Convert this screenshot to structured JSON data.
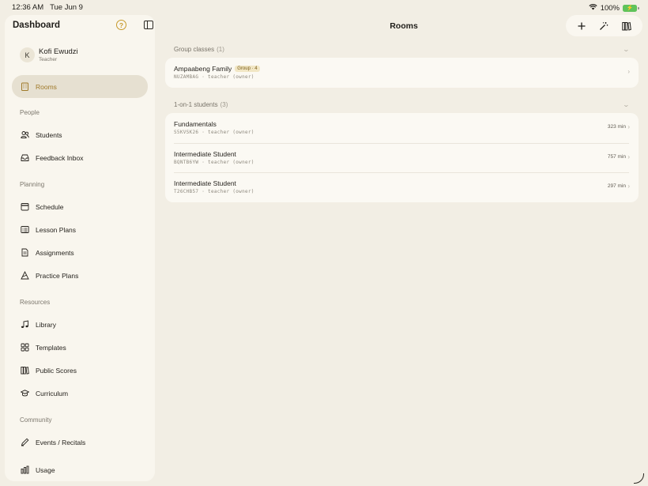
{
  "status": {
    "time": "12:36 AM",
    "date": "Tue Jun 9",
    "battery": "100%"
  },
  "sidebar": {
    "title": "Dashboard",
    "profile": {
      "initial": "K",
      "name": "Kofi Ewudzi",
      "role": "Teacher"
    },
    "items": [
      {
        "label": "Rooms",
        "icon": "building-icon"
      },
      {
        "label": "Students",
        "icon": "people-icon"
      },
      {
        "label": "Feedback Inbox",
        "icon": "inbox-icon"
      },
      {
        "label": "Schedule",
        "icon": "calendar-icon"
      },
      {
        "label": "Lesson Plans",
        "icon": "list-icon"
      },
      {
        "label": "Assignments",
        "icon": "document-icon"
      },
      {
        "label": "Practice Plans",
        "icon": "practice-icon"
      },
      {
        "label": "Library",
        "icon": "music-notes-icon"
      },
      {
        "label": "Templates",
        "icon": "grid-icon"
      },
      {
        "label": "Public Scores",
        "icon": "books-icon"
      },
      {
        "label": "Curriculum",
        "icon": "graduation-cap-icon"
      },
      {
        "label": "Events / Recitals",
        "icon": "pen-icon"
      },
      {
        "label": "Usage",
        "icon": "chart-icon"
      }
    ],
    "sections": [
      "People",
      "Planning",
      "Resources",
      "Community"
    ]
  },
  "main": {
    "title": "Rooms",
    "groups": [
      {
        "title": "Group classes",
        "count": "(1)",
        "rows": [
          {
            "title": "Ampaabeng Family",
            "badge": "Group · 4",
            "sub": "NUZAMBAG · teacher (owner)",
            "meta": ""
          }
        ]
      },
      {
        "title": "1-on-1 students",
        "count": "(3)",
        "rows": [
          {
            "title": "Fundamentals",
            "sub": "S5KVSK26 · teacher (owner)",
            "meta": "323 min"
          },
          {
            "title": "Intermediate Student",
            "sub": "BQNTB6YW · teacher (owner)",
            "meta": "757 min"
          },
          {
            "title": "Intermediate Student",
            "sub": "T26CHB57 · teacher (owner)",
            "meta": "297 min"
          }
        ]
      }
    ]
  },
  "accent_color": "#a07a2a"
}
